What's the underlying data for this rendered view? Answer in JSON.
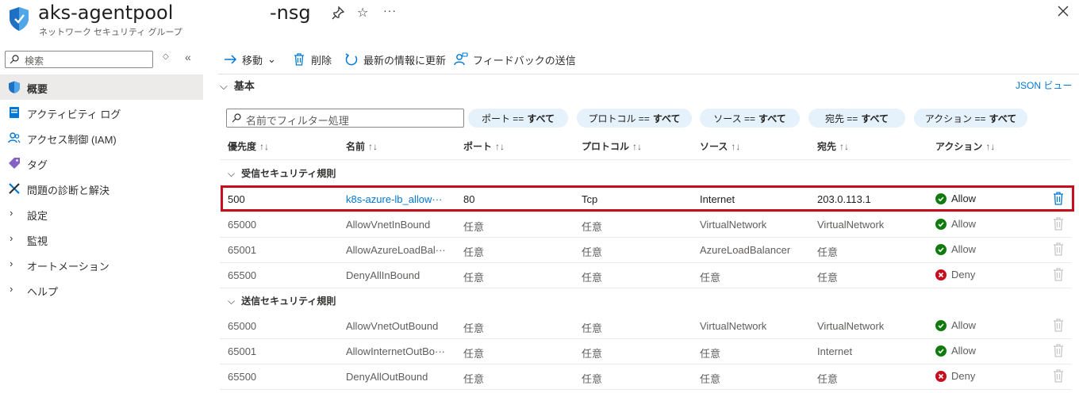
{
  "header": {
    "title": "aks-agentpool",
    "title_suffix": "-nsg",
    "subtitle": "ネットワーク セキュリティ グループ",
    "more_label": "···"
  },
  "sidebar": {
    "search_placeholder": "検索",
    "updown": "◇",
    "collapse": "«",
    "items": [
      {
        "label": "概要",
        "icon": "shield-icon",
        "selected": true
      },
      {
        "label": "アクティビティ ログ",
        "icon": "log-icon"
      },
      {
        "label": "アクセス制御 (IAM)",
        "icon": "people-icon"
      },
      {
        "label": "タグ",
        "icon": "tag-icon"
      },
      {
        "label": "問題の診断と解決",
        "icon": "wrench-icon"
      },
      {
        "label": "設定",
        "icon": "chevron-right-icon"
      },
      {
        "label": "監視",
        "icon": "chevron-right-icon"
      },
      {
        "label": "オートメーション",
        "icon": "chevron-right-icon"
      },
      {
        "label": "ヘルプ",
        "icon": "chevron-right-icon"
      }
    ]
  },
  "toolbar": {
    "move": "移動",
    "delete": "削除",
    "refresh": "最新の情報に更新",
    "feedback": "フィードバックの送信"
  },
  "essentials": {
    "label": "基本",
    "json_view": "JSON ビュー"
  },
  "filters": {
    "search_placeholder": "名前でフィルター処理",
    "pills": [
      {
        "key": "ポート ==",
        "value": "すべて"
      },
      {
        "key": "プロトコル ==",
        "value": "すべて"
      },
      {
        "key": "ソース ==",
        "value": "すべて"
      },
      {
        "key": "宛先 ==",
        "value": "すべて"
      },
      {
        "key": "アクション ==",
        "value": "すべて"
      }
    ]
  },
  "table": {
    "columns": [
      "優先度",
      "名前",
      "ポート",
      "プロトコル",
      "ソース",
      "宛先",
      "アクション"
    ],
    "sort_glyph": "↑↓",
    "inbound_label": "受信セキュリティ規則",
    "outbound_label": "送信セキュリティ規則",
    "inbound": [
      {
        "priority": "500",
        "name": "k8s-azure-lb_allow···",
        "port": "80",
        "protocol": "Tcp",
        "source": "Internet",
        "dest": "203.0.113.1",
        "action": "Allow"
      },
      {
        "priority": "65000",
        "name": "AllowVnetInBound",
        "port": "任意",
        "protocol": "任意",
        "source": "VirtualNetwork",
        "dest": "VirtualNetwork",
        "action": "Allow"
      },
      {
        "priority": "65001",
        "name": "AllowAzureLoadBal···",
        "port": "任意",
        "protocol": "任意",
        "source": "AzureLoadBalancer",
        "dest": "任意",
        "action": "Allow"
      },
      {
        "priority": "65500",
        "name": "DenyAllInBound",
        "port": "任意",
        "protocol": "任意",
        "source": "任意",
        "dest": "任意",
        "action": "Deny"
      }
    ],
    "outbound": [
      {
        "priority": "65000",
        "name": "AllowVnetOutBound",
        "port": "任意",
        "protocol": "任意",
        "source": "VirtualNetwork",
        "dest": "VirtualNetwork",
        "action": "Allow"
      },
      {
        "priority": "65001",
        "name": "AllowInternetOutBo···",
        "port": "任意",
        "protocol": "任意",
        "source": "任意",
        "dest": "Internet",
        "action": "Allow"
      },
      {
        "priority": "65500",
        "name": "DenyAllOutBound",
        "port": "任意",
        "protocol": "任意",
        "source": "任意",
        "dest": "任意",
        "action": "Deny"
      }
    ]
  },
  "colors": {
    "accent": "#0078d4",
    "allow": "#107c10",
    "deny": "#c50f1f",
    "highlight_border": "#c50f1f"
  }
}
